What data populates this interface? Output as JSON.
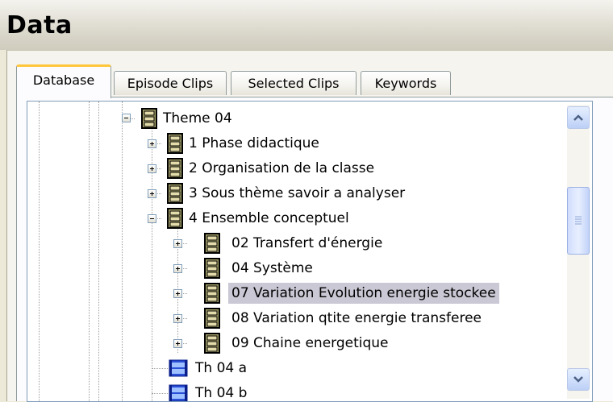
{
  "window": {
    "title": "Data"
  },
  "tabs": [
    {
      "label": "Database",
      "active": true
    },
    {
      "label": "Episode Clips",
      "active": false
    },
    {
      "label": "Selected Clips",
      "active": false
    },
    {
      "label": "Keywords",
      "active": false
    }
  ],
  "tree": {
    "nodes": [
      {
        "label": "Theme 04",
        "icon": "keyword-group-icon",
        "expander": "minus",
        "selected": false
      },
      {
        "label": "1 Phase didactique",
        "icon": "keyword-group-icon",
        "expander": "plus",
        "selected": false
      },
      {
        "label": "2 Organisation de la classe",
        "icon": "keyword-group-icon",
        "expander": "plus",
        "selected": false
      },
      {
        "label": "3 Sous thème savoir a analyser",
        "icon": "keyword-group-icon",
        "expander": "plus",
        "selected": false
      },
      {
        "label": "4 Ensemble conceptuel",
        "icon": "keyword-group-icon",
        "expander": "minus",
        "selected": false
      },
      {
        "label": "02 Transfert d'énergie",
        "icon": "keyword-group-icon",
        "expander": "plus",
        "selected": false
      },
      {
        "label": "04 Système",
        "icon": "keyword-group-icon",
        "expander": "plus",
        "selected": false
      },
      {
        "label": "07 Variation Evolution energie stockee",
        "icon": "keyword-group-icon",
        "expander": "plus",
        "selected": true
      },
      {
        "label": "08 Variation qtite energie transferee",
        "icon": "keyword-group-icon",
        "expander": "plus",
        "selected": false
      },
      {
        "label": "09 Chaine energetique",
        "icon": "keyword-group-icon",
        "expander": "plus",
        "selected": false
      },
      {
        "label": "Th 04 a",
        "icon": "episode-icon",
        "expander": "none",
        "selected": false
      },
      {
        "label": "Th 04 b",
        "icon": "episode-icon",
        "expander": "none",
        "selected": false
      }
    ]
  },
  "colors": {
    "selection": "#c9c8d4",
    "active_tab_accent": "#ffc83c",
    "scrollbar": "#c3d3f8"
  }
}
